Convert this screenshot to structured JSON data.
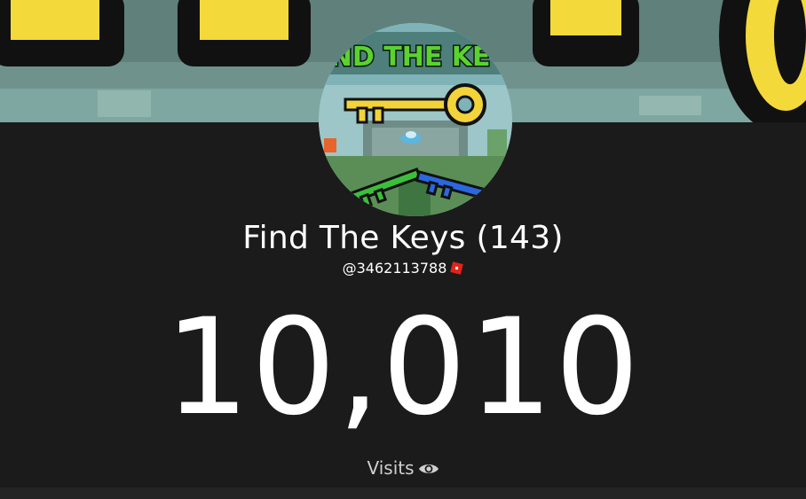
{
  "game": {
    "title": "Find The Keys (143)",
    "handle": "@3462113788",
    "thumbnail_text": "FIND THE KEYS"
  },
  "stats": {
    "count": "10,010",
    "label": "Visits"
  },
  "icons": {
    "platform": "roblox-icon",
    "views": "eye-icon"
  },
  "colors": {
    "background": "#1b1b1b",
    "text": "#ffffff",
    "muted_text": "#cfcfcf",
    "roblox_red": "#e2231a"
  }
}
